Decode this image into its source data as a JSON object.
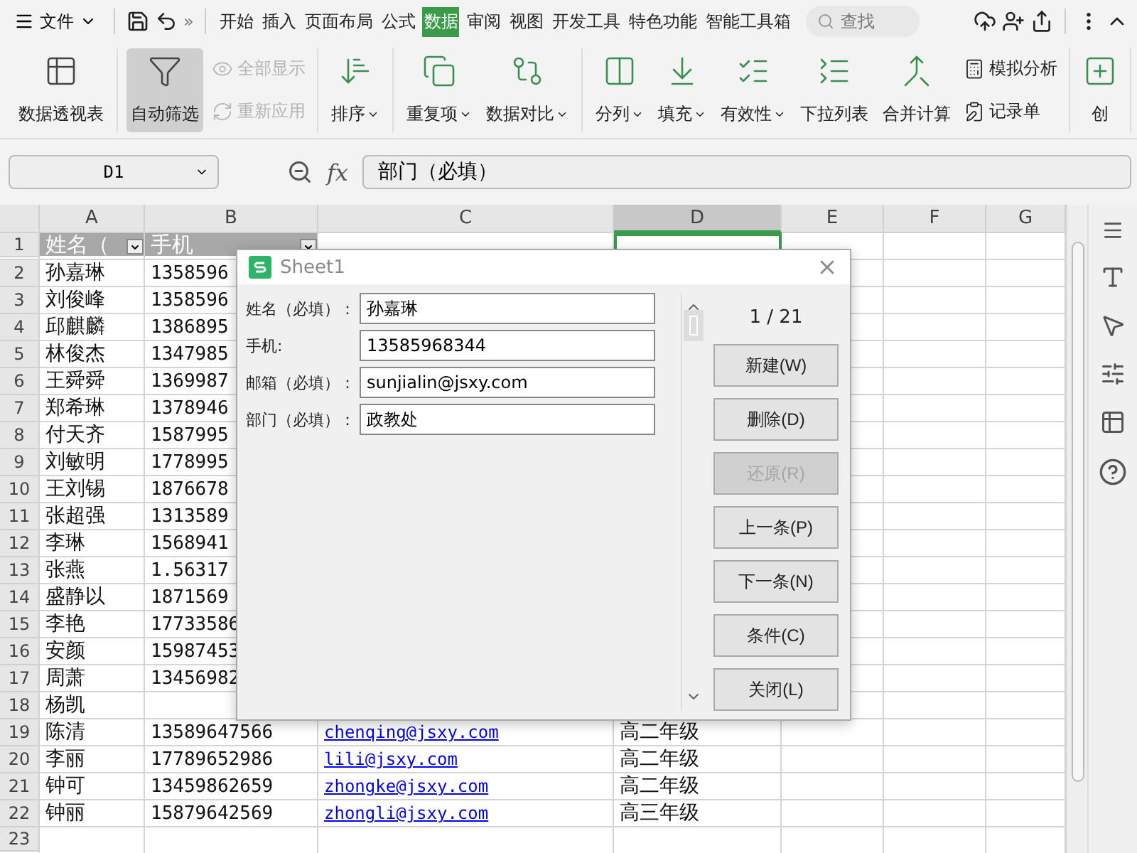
{
  "menu": {
    "file": "文件",
    "more": "»",
    "tabs": [
      {
        "label": "开始",
        "selected": false
      },
      {
        "label": "插入",
        "selected": false
      },
      {
        "label": "页面布局",
        "selected": false
      },
      {
        "label": "公式",
        "selected": false
      },
      {
        "label": "数据",
        "selected": true
      },
      {
        "label": "审阅",
        "selected": false
      },
      {
        "label": "视图",
        "selected": false
      },
      {
        "label": "开发工具",
        "selected": false
      },
      {
        "label": "特色功能",
        "selected": false
      },
      {
        "label": "智能工具箱",
        "selected": false
      }
    ],
    "search": {
      "placeholder": "查找"
    }
  },
  "ribbon": [
    [
      {
        "kind": "large",
        "label": "数据透视表",
        "dropdown": false,
        "active": false
      }
    ],
    [
      {
        "kind": "large",
        "label": "自动筛选",
        "dropdown": false,
        "active": true
      },
      {
        "kind": "small",
        "label": "全部显示",
        "disabled": true
      },
      {
        "kind": "small",
        "label": "重新应用",
        "disabled": true
      }
    ],
    [
      {
        "kind": "large",
        "label": "排序",
        "dropdown": true,
        "active": false
      }
    ],
    [
      {
        "kind": "large",
        "label": "重复项",
        "dropdown": true,
        "active": false
      },
      {
        "kind": "large",
        "label": "数据对比",
        "dropdown": true,
        "active": false
      }
    ],
    [
      {
        "kind": "large",
        "label": "分列",
        "dropdown": true,
        "active": false
      },
      {
        "kind": "large",
        "label": "填充",
        "dropdown": true,
        "active": false
      },
      {
        "kind": "large",
        "label": "有效性",
        "dropdown": true,
        "active": false
      },
      {
        "kind": "large",
        "label": "下拉列表",
        "dropdown": false,
        "active": false
      },
      {
        "kind": "large",
        "label": "合并计算",
        "dropdown": false,
        "active": false
      },
      {
        "kind": "small",
        "label": "模拟分析",
        "disabled": false
      },
      {
        "kind": "small",
        "label": "记录单",
        "disabled": false
      }
    ],
    [
      {
        "kind": "large",
        "label": "创",
        "dropdown": false,
        "active": false
      }
    ]
  ],
  "formula_bar": {
    "name_box": "D1",
    "fx": "fx",
    "value": "部门（必填）"
  },
  "sheet": {
    "columns": [
      {
        "label": "A",
        "selected": false
      },
      {
        "label": "B",
        "selected": false
      },
      {
        "label": "C",
        "selected": false
      },
      {
        "label": "D",
        "selected": true
      },
      {
        "label": "E",
        "selected": false
      },
      {
        "label": "F",
        "selected": false
      },
      {
        "label": "G",
        "selected": false
      }
    ],
    "rows": [
      {
        "number": "1",
        "kind": "header",
        "cells": [
          "姓名（",
          "手机"
        ]
      },
      {
        "number": "2",
        "kind": "data",
        "cells": [
          "孙嘉琳",
          "1358596"
        ]
      },
      {
        "number": "3",
        "kind": "data",
        "cells": [
          "刘俊峰",
          "1358596"
        ]
      },
      {
        "number": "4",
        "kind": "data",
        "cells": [
          "邱麒麟",
          "1386895"
        ]
      },
      {
        "number": "5",
        "kind": "data",
        "cells": [
          "林俊杰",
          "1347985"
        ]
      },
      {
        "number": "6",
        "kind": "data",
        "cells": [
          "王舜舜",
          "1369987"
        ]
      },
      {
        "number": "7",
        "kind": "data",
        "cells": [
          "郑希琳",
          "1378946"
        ]
      },
      {
        "number": "8",
        "kind": "data",
        "cells": [
          "付天齐",
          "1587995"
        ]
      },
      {
        "number": "9",
        "kind": "data",
        "cells": [
          "刘敏明",
          "1778995"
        ]
      },
      {
        "number": "10",
        "kind": "data",
        "cells": [
          "王刘锡",
          "1876678"
        ]
      },
      {
        "number": "11",
        "kind": "data",
        "cells": [
          "张超强",
          "1313589"
        ]
      },
      {
        "number": "12",
        "kind": "data",
        "cells": [
          "李琳",
          "1568941"
        ]
      },
      {
        "number": "13",
        "kind": "data",
        "cells": [
          "张燕",
          "1.56317"
        ]
      },
      {
        "number": "14",
        "kind": "data",
        "cells": [
          "盛静以",
          "1871569"
        ]
      },
      {
        "number": "15",
        "kind": "data",
        "cells": [
          "李艳",
          "17733586"
        ]
      },
      {
        "number": "16",
        "kind": "data",
        "cells": [
          "安颜",
          "15987453"
        ]
      },
      {
        "number": "17",
        "kind": "data",
        "cells": [
          "周萧",
          "13456982"
        ]
      },
      {
        "number": "18",
        "kind": "data",
        "cells": [
          "杨凯"
        ]
      },
      {
        "number": "19",
        "kind": "data",
        "cells": [
          "陈清",
          "13589647566",
          "chenqing@jsxy.com",
          "高二年级"
        ]
      },
      {
        "number": "20",
        "kind": "data",
        "cells": [
          "李丽",
          "17789652986",
          "lili@jsxy.com",
          "高二年级"
        ]
      },
      {
        "number": "21",
        "kind": "data",
        "cells": [
          "钟可",
          "13459862659",
          "zhongke@jsxy.com",
          "高二年级"
        ]
      },
      {
        "number": "22",
        "kind": "data",
        "cells": [
          "钟丽",
          "15879642569",
          "zhongli@jsxy.com",
          "高三年级"
        ]
      },
      {
        "number": "23",
        "kind": "data",
        "cells": []
      }
    ]
  },
  "dialog": {
    "title": "Sheet1",
    "fields": [
      {
        "label": "姓名（必填）：",
        "value": "孙嘉琳"
      },
      {
        "label": "手机:",
        "value": "13585968344"
      },
      {
        "label": "邮箱（必填）：",
        "value": "sunjialin@jsxy.com"
      },
      {
        "label": "部门（必填）：",
        "value": "政教处"
      }
    ],
    "counter": "1 / 21",
    "buttons": [
      {
        "label": "新建(W)",
        "disabled": false
      },
      {
        "label": "删除(D)",
        "disabled": false
      },
      {
        "label": "还原(R)",
        "disabled": true
      },
      {
        "label": "上一条(P)",
        "disabled": false
      },
      {
        "label": "下一条(N)",
        "disabled": false
      },
      {
        "label": "条件(C)",
        "disabled": false
      },
      {
        "label": "关闭(L)",
        "disabled": false
      }
    ]
  }
}
